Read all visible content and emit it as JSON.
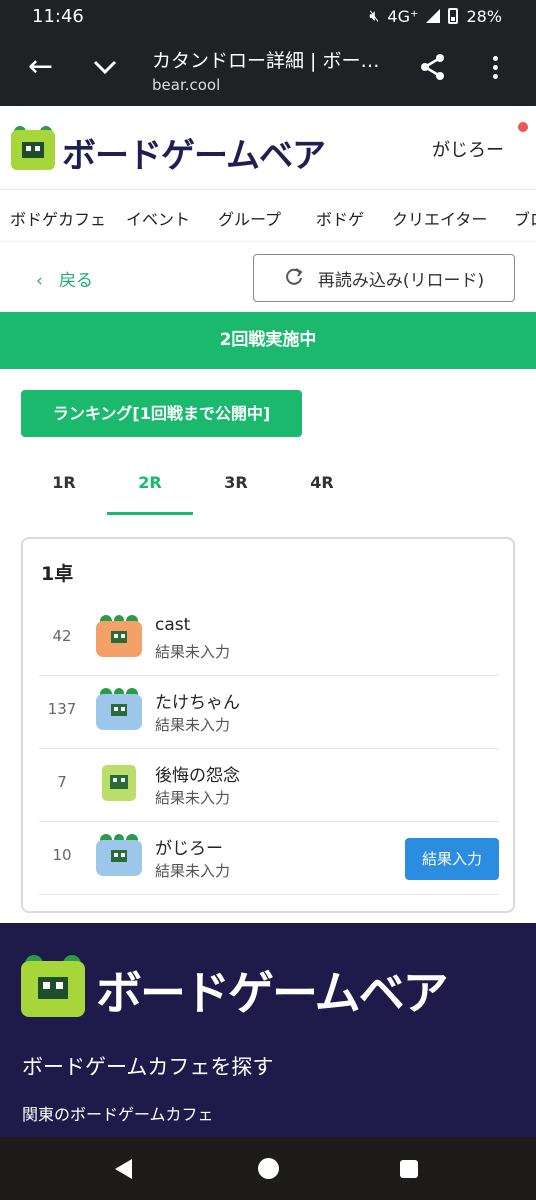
{
  "status_bar": {
    "time": "11:46",
    "network": "4G⁺",
    "battery": "28%"
  },
  "browser": {
    "title": "カタンドロー詳細 | ボードゲームベア",
    "url": "bear.cool"
  },
  "site": {
    "logo_text": "ボードゲームベア",
    "user_name": "がじろー"
  },
  "nav": {
    "items": [
      "ボドゲカフェ",
      "イベント",
      "グループ",
      "ボドゲ",
      "クリエイター",
      "ブロ"
    ]
  },
  "actions": {
    "back_label": "戻る",
    "reload_label": "再読み込み(リロード)"
  },
  "round_status": "2回戦実施中",
  "ranking_label": "ランキング[1回戦まで公開中]",
  "tabs": [
    {
      "label": "1R",
      "active": false
    },
    {
      "label": "2R",
      "active": true
    },
    {
      "label": "3R",
      "active": false
    },
    {
      "label": "4R",
      "active": false
    }
  ],
  "table": {
    "title": "1卓",
    "players": [
      {
        "number": "42",
        "name": "cast",
        "status": "結果未入力",
        "avatar": "orange"
      },
      {
        "number": "137",
        "name": "たけちゃん",
        "status": "結果未入力",
        "avatar": "blue"
      },
      {
        "number": "7",
        "name": "後悔の怨念",
        "status": "結果未入力",
        "avatar": "green"
      },
      {
        "number": "10",
        "name": "がじろー",
        "status": "結果未入力",
        "avatar": "blue"
      }
    ],
    "result_button": "結果入力"
  },
  "footer": {
    "logo_text": "ボードゲームベア",
    "heading": "ボードゲームカフェを探す",
    "sub": "関東のボードゲームカフェ"
  },
  "colors": {
    "green": "#1ab96d",
    "navy": "#1e1b4b",
    "blue_button": "#2b8de0"
  }
}
